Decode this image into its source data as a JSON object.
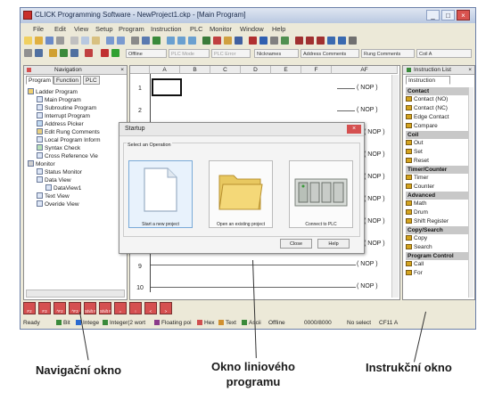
{
  "window": {
    "title": "CLICK Programming Software - NewProject1.ckp - [Main Program]",
    "controls": [
      "_",
      "□",
      "×"
    ]
  },
  "menu": [
    "File",
    "Edit",
    "View",
    "Setup",
    "Program",
    "Instruction",
    "PLC",
    "Monitor",
    "Window",
    "Help"
  ],
  "toolbar2": {
    "offline": "Offline",
    "plc_mode": "PLC Mode",
    "plc_error": "PLC Error",
    "nicknames": "Nicknames",
    "address_comments": "Address Comments",
    "rung_comments": "Rung Comments",
    "coil_a": "Coil A"
  },
  "navigation": {
    "title": "Navigation",
    "tabs": [
      "Program",
      "Function",
      "PLC"
    ],
    "tree": [
      "Ladder Program",
      "Main Program",
      "Subroutine Program",
      "Interrupt Program",
      "Address Picker",
      "Edit Rung Comments",
      "Local Program Inform",
      "Syntax Check",
      "Cross Reference Vie",
      "Monitor",
      "Status Monitor",
      "Data View",
      "DataView1",
      "Text View",
      "Overide View"
    ]
  },
  "ladder": {
    "columns": [
      "A",
      "B",
      "C",
      "D",
      "E",
      "F",
      "AF"
    ],
    "rows": [
      "1",
      "2",
      "9",
      "10"
    ],
    "nop": "( NOP )"
  },
  "instruction_list": {
    "title": "Instruction List",
    "tab": "Instruction",
    "categories": [
      {
        "name": "Contact",
        "items": [
          "Contact (NO)",
          "Contact (NC)",
          "Edge Contact",
          "Compare"
        ]
      },
      {
        "name": "Coil",
        "items": [
          "Out",
          "Set",
          "Reset"
        ]
      },
      {
        "name": "Timer/Counter",
        "items": [
          "Timer",
          "Counter"
        ]
      },
      {
        "name": "Advanced",
        "items": [
          "Math",
          "Drum",
          "Shift Register"
        ]
      },
      {
        "name": "Copy/Search",
        "items": [
          "Copy",
          "Search"
        ]
      },
      {
        "name": "Program Control",
        "items": [
          "Call",
          "For"
        ]
      }
    ]
  },
  "dialog": {
    "title": "Startup",
    "group": "Select an Operation",
    "options": [
      "Start a new project",
      "Open an existing project",
      "Connect to PLC"
    ],
    "close": "Close",
    "help": "Help"
  },
  "bottom_keys": [
    "F2",
    "F3",
    "^F2",
    "^F3",
    "Shift F2",
    "Shift F3",
    "=",
    "↑",
    "<",
    ">"
  ],
  "status": {
    "ready": "Ready",
    "bit": "Bit",
    "integer": "Intege",
    "integer2": "Integer(2 wort",
    "floating": "Floating poi",
    "hex": "Hex",
    "text": "Text",
    "ascii": "Ascii",
    "offline": "Offline",
    "count": "0000/8000",
    "no_select": "No select",
    "cell": "CF11 A"
  },
  "captions": {
    "navigation": "Navigační okno",
    "program": "Okno liniového programu",
    "program_line1": "Okno liniového",
    "program_line2": "programu",
    "instruction": "Instrukční okno"
  },
  "colors": {
    "accent": "#d55050",
    "panel_bg": "#ece9d8",
    "category_bg": "#c8c8c8"
  }
}
